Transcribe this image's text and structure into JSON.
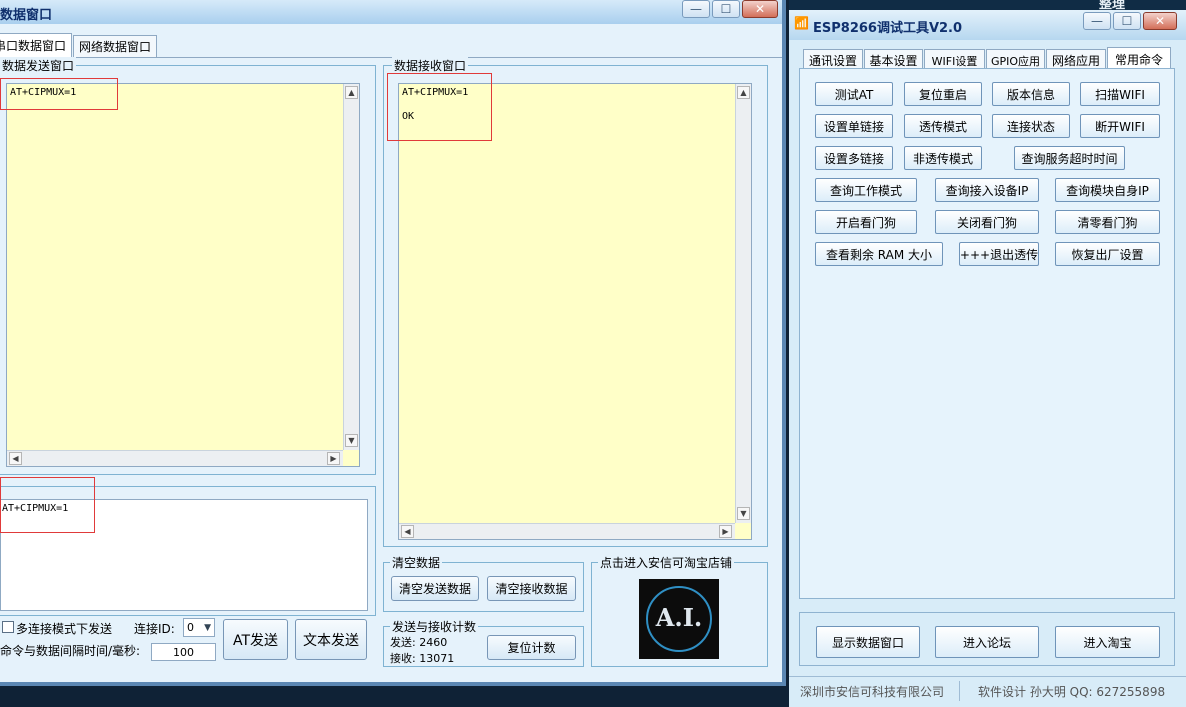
{
  "left_window": {
    "title": "数据窗口",
    "caption_buttons": [
      "—",
      "☐",
      "✕"
    ],
    "tabs": [
      "串口数据窗口",
      "网络数据窗口"
    ],
    "send_group": {
      "label": "数据发送窗口",
      "text": "AT+CIPMUX=1"
    },
    "recv_group": {
      "label": "数据接收窗口",
      "lines": [
        "AT+CIPMUX=1",
        "OK"
      ]
    },
    "command_input": {
      "value": "AT+CIPMUX=1"
    },
    "multi_connect_label": "多连接模式下发送",
    "connect_id_label": "连接ID:",
    "connect_id_value": "0",
    "interval_label": "命令与数据间隔时间/毫秒:",
    "interval_value": "100",
    "at_send_label": "AT发送",
    "text_send_label": "文本发送",
    "clear_group": {
      "label": "清空数据",
      "clear_send": "清空发送数据",
      "clear_recv": "清空接收数据"
    },
    "count_group": {
      "label": "发送与接收计数",
      "send": "发送: 2460",
      "recv": "接收: 13071",
      "reset": "复位计数"
    },
    "shop_group": {
      "label": "点击进入安信可淘宝店铺",
      "logo_text": "A.I."
    }
  },
  "right_window": {
    "title": "ESP8266调试工具V2.0",
    "caption_buttons": [
      "—",
      "☐",
      "✕"
    ],
    "taskbar_label": "整理",
    "tabs": [
      "通讯设置",
      "基本设置",
      "WIFI设置",
      "GPIO应用",
      "网络应用",
      "常用命令"
    ],
    "buttons": {
      "row1": [
        "测试AT",
        "复位重启",
        "版本信息",
        "扫描WIFI"
      ],
      "row2": [
        "设置单链接",
        "透传模式",
        "连接状态",
        "断开WIFI"
      ],
      "row3": [
        "设置多链接",
        "非透传模式",
        "查询服务超时时间"
      ],
      "row4": [
        "查询工作模式",
        "查询接入设备IP",
        "查询模块自身IP"
      ],
      "row5": [
        "开启看门狗",
        "关闭看门狗",
        "清零看门狗"
      ],
      "row6": [
        "查看剩余 RAM 大小",
        "+++退出透传",
        "恢复出厂设置"
      ]
    },
    "bottom_buttons": [
      "显示数据窗口",
      "进入论坛",
      "进入淘宝"
    ],
    "status_company": "深圳市安信可科技有限公司",
    "status_author": "软件设计 孙大明 QQ: 627255898"
  }
}
